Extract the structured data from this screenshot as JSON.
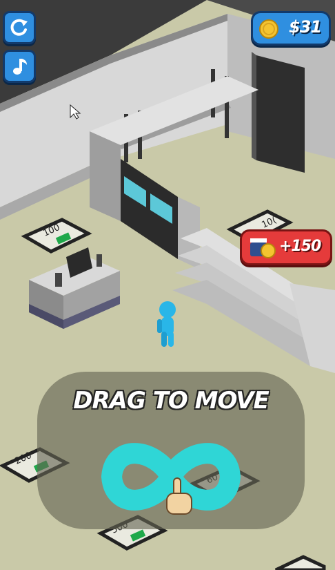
{
  "hud": {
    "restart_icon": "restart-icon",
    "music_icon": "music-note-icon",
    "coins": "$31",
    "coin_icon": "coin-icon"
  },
  "reward": {
    "label": "+150",
    "icon": "video-ad-icon"
  },
  "pads": [
    {
      "label": "100"
    },
    {
      "label": "10("
    },
    {
      "label": "200"
    },
    {
      "label": "500"
    },
    {
      "label": "60"
    }
  ],
  "tutorial": {
    "text": "DRAG TO MOVE",
    "icon": "infinity-drag-icon",
    "hand_icon": "pointing-hand-icon"
  },
  "colors": {
    "hud_blue": "#2f8fe0",
    "reward_red": "#e53b3b",
    "floor": "#c9c9a8",
    "player": "#29b6e8",
    "tutorial_cyan": "#2fd6d6"
  }
}
